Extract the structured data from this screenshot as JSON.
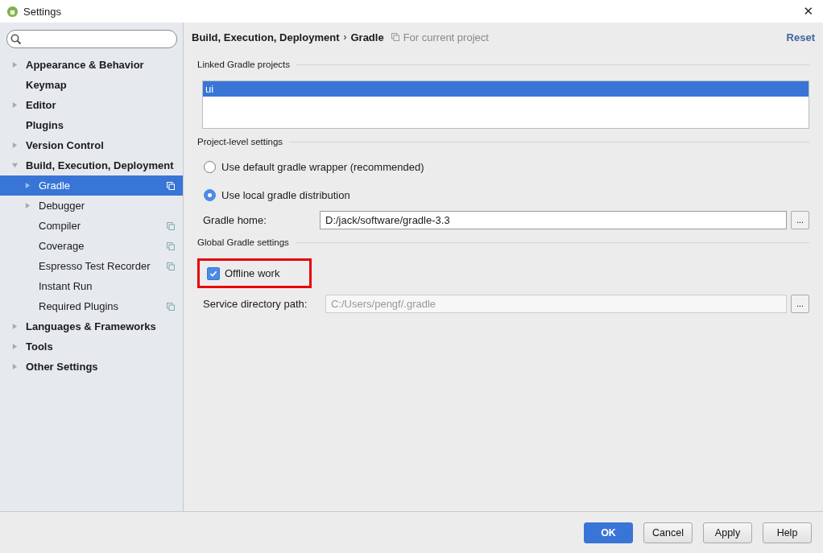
{
  "window": {
    "title": "Settings",
    "close": "✕"
  },
  "sidebar": {
    "items": [
      {
        "label": "Appearance & Behavior",
        "expanded": false,
        "selected": false,
        "project_level": false
      },
      {
        "label": "Keymap",
        "selected": false,
        "project_level": false
      },
      {
        "label": "Editor",
        "expanded": false,
        "selected": false,
        "project_level": false
      },
      {
        "label": "Plugins",
        "selected": false,
        "project_level": false
      },
      {
        "label": "Version Control",
        "expanded": false,
        "selected": false,
        "project_level": false
      },
      {
        "label": "Build, Execution, Deployment",
        "expanded": true,
        "selected": false,
        "project_level": false,
        "children": [
          {
            "label": "Gradle",
            "expanded": false,
            "selected": true,
            "project_level": true
          },
          {
            "label": "Debugger",
            "expanded": false,
            "selected": false,
            "project_level": false
          },
          {
            "label": "Compiler",
            "selected": false,
            "project_level": true
          },
          {
            "label": "Coverage",
            "selected": false,
            "project_level": true
          },
          {
            "label": "Espresso Test Recorder",
            "selected": false,
            "project_level": true
          },
          {
            "label": "Instant Run",
            "selected": false,
            "project_level": false
          },
          {
            "label": "Required Plugins",
            "selected": false,
            "project_level": true
          }
        ]
      },
      {
        "label": "Languages & Frameworks",
        "expanded": false,
        "selected": false,
        "project_level": false
      },
      {
        "label": "Tools",
        "expanded": false,
        "selected": false,
        "project_level": false
      },
      {
        "label": "Other Settings",
        "expanded": false,
        "selected": false,
        "project_level": false
      }
    ]
  },
  "header": {
    "breadcrumb": [
      "Build, Execution, Deployment",
      "Gradle"
    ],
    "separator": "›",
    "scope": "For current project",
    "reset": "Reset"
  },
  "linked_projects": {
    "title": "Linked Gradle projects",
    "items": [
      {
        "label": "ui",
        "selected": true
      }
    ]
  },
  "project_settings": {
    "title": "Project-level settings",
    "options": [
      {
        "label": "Use default gradle wrapper (recommended)",
        "selected": false
      },
      {
        "label": "Use local gradle distribution",
        "selected": true
      }
    ],
    "gradle_home": {
      "label": "Gradle home:",
      "value": "D:/jack/software/gradle-3.3",
      "browse": "...",
      "disabled": false
    }
  },
  "global_settings": {
    "title": "Global Gradle settings",
    "offline_work": {
      "label": "Offline work",
      "checked": true,
      "highlighted": true
    },
    "service_directory": {
      "label": "Service directory path:",
      "placeholder": "C:/Users/pengf/.gradle",
      "browse": "...",
      "disabled": true
    }
  },
  "buttons": [
    {
      "label": "OK",
      "kind": "primary"
    },
    {
      "label": "Cancel",
      "kind": "default"
    },
    {
      "label": "Apply",
      "kind": "default"
    },
    {
      "label": "Help",
      "kind": "default"
    }
  ]
}
